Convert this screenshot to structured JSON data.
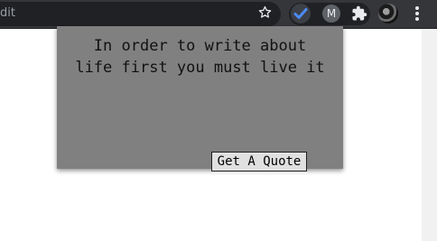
{
  "browser": {
    "omnibox_text": "dit",
    "extensions": [
      {
        "name": "todo-check",
        "icon": "check-icon"
      },
      {
        "name": "m-extension",
        "label": "M"
      },
      {
        "name": "extensions",
        "icon": "puzzle-icon"
      }
    ],
    "profile": "avatar",
    "menu": "more-vert-icon"
  },
  "quote_card": {
    "quote_line_1": "In order to write about",
    "quote_line_2": "life first you must live it",
    "button_label": "Get A Quote",
    "background_color": "#808080"
  }
}
